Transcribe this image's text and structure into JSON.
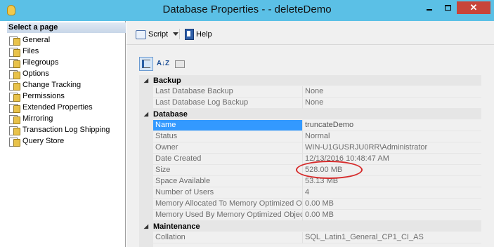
{
  "window": {
    "title": "Database Properties - - deleteDemo",
    "minimize_glyph": "",
    "maximize_glyph": "",
    "close_glyph": "✕",
    "icon": "database-icon"
  },
  "left_panel": {
    "header": "Select a page",
    "selected": "General",
    "items": [
      {
        "label": "General",
        "icon": "page-wrench-icon"
      },
      {
        "label": "Files",
        "icon": "page-wrench-icon"
      },
      {
        "label": "Filegroups",
        "icon": "page-wrench-icon"
      },
      {
        "label": "Options",
        "icon": "page-wrench-icon"
      },
      {
        "label": "Change Tracking",
        "icon": "page-wrench-icon"
      },
      {
        "label": "Permissions",
        "icon": "page-wrench-icon"
      },
      {
        "label": "Extended Properties",
        "icon": "page-wrench-icon"
      },
      {
        "label": "Mirroring",
        "icon": "page-wrench-icon"
      },
      {
        "label": "Transaction Log Shipping",
        "icon": "page-wrench-icon"
      },
      {
        "label": "Query Store",
        "icon": "page-wrench-icon"
      }
    ]
  },
  "toolbar": {
    "script_label": "Script",
    "help_label": "Help"
  },
  "grid": {
    "sort_az_label": "A↓Z",
    "categories": [
      {
        "name": "Backup",
        "collapse_glyph": "◢",
        "rows": [
          {
            "name": "Last Database Backup",
            "value": "None"
          },
          {
            "name": "Last Database Log Backup",
            "value": "None"
          }
        ]
      },
      {
        "name": "Database",
        "collapse_glyph": "◢",
        "rows": [
          {
            "name": "Name",
            "value": "truncateDemo"
          },
          {
            "name": "Status",
            "value": "Normal"
          },
          {
            "name": "Owner",
            "value": "WIN-U1GUSRJU0RR\\Administrator"
          },
          {
            "name": "Date Created",
            "value": "12/13/2016 10:48:47 AM"
          },
          {
            "name": "Size",
            "value": "528.00 MB"
          },
          {
            "name": "Space Available",
            "value": "53.13 MB"
          },
          {
            "name": "Number of Users",
            "value": "4"
          },
          {
            "name": "Memory Allocated To Memory Optimized Obj",
            "value": "0.00 MB"
          },
          {
            "name": "Memory Used By Memory Optimized Objects",
            "value": "0.00 MB"
          }
        ]
      },
      {
        "name": "Maintenance",
        "collapse_glyph": "◢",
        "rows": [
          {
            "name": "Collation",
            "value": "SQL_Latin1_General_CP1_CI_AS"
          }
        ]
      }
    ],
    "selected_row": "Name",
    "highlight_color": "#d62b2b",
    "selection_color": "#3399ff"
  },
  "colors": {
    "titlebar": "#5bc0e6",
    "close_button": "#c7453a",
    "gutter": "#e6e6e6"
  }
}
